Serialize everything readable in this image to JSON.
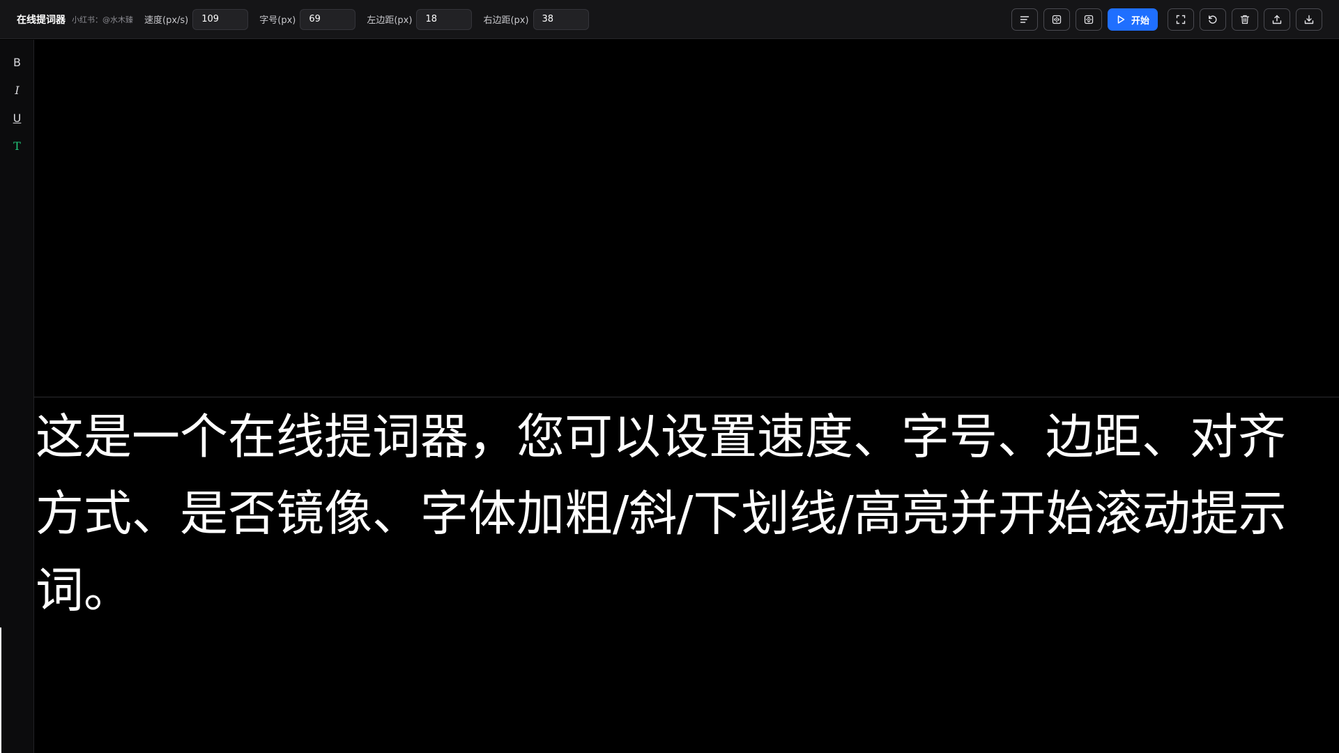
{
  "header": {
    "title": "在线提词器",
    "subtitle": "小红书：@水木臻",
    "fields": {
      "speed": {
        "label": "速度(px/s)",
        "value": "109"
      },
      "font_size": {
        "label": "字号(px)",
        "value": "69"
      },
      "margin_left": {
        "label": "左边距(px)",
        "value": "18"
      },
      "margin_right": {
        "label": "右边距(px)",
        "value": "38"
      }
    },
    "start_label": "开始"
  },
  "sidebar": {
    "bold": "B",
    "italic": "I",
    "underline": "U",
    "highlight": "T"
  },
  "script": {
    "text": "这是一个在线提词器，您可以设置速度、字号、边距、对齐方式、是否镜像、字体加粗/斜/下划线/高亮并开始滚动提示词。"
  },
  "colors": {
    "accent": "#1f6fff",
    "highlight": "#22c77a",
    "background": "#000000",
    "toolbar": "#151517"
  },
  "icons": [
    "align-left-icon",
    "mirror-horizontal-icon",
    "mirror-vertical-icon",
    "play-icon",
    "fullscreen-icon",
    "reset-icon",
    "trash-icon",
    "upload-icon",
    "download-icon"
  ]
}
